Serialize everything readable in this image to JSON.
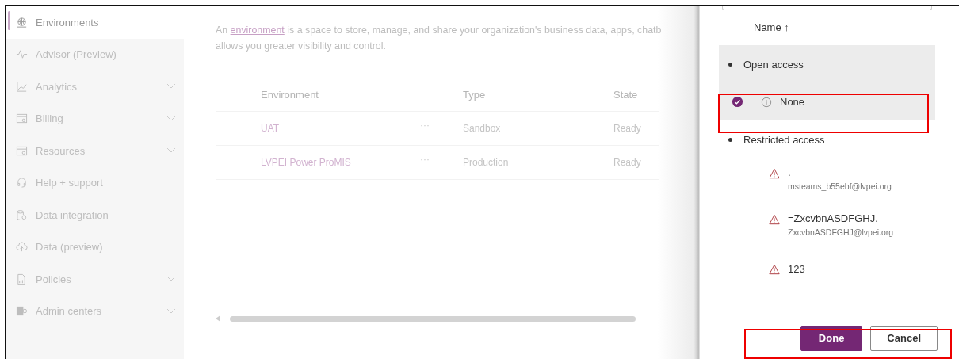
{
  "sidebar": {
    "items": [
      {
        "label": "Environments",
        "selected": true,
        "expandable": false
      },
      {
        "label": "Advisor (Preview)",
        "selected": false,
        "expandable": false
      },
      {
        "label": "Analytics",
        "selected": false,
        "expandable": true
      },
      {
        "label": "Billing",
        "selected": false,
        "expandable": true
      },
      {
        "label": "Resources",
        "selected": false,
        "expandable": true
      },
      {
        "label": "Help + support",
        "selected": false,
        "expandable": false
      },
      {
        "label": "Data integration",
        "selected": false,
        "expandable": false
      },
      {
        "label": "Data (preview)",
        "selected": false,
        "expandable": false
      },
      {
        "label": "Policies",
        "selected": false,
        "expandable": true
      },
      {
        "label": "Admin centers",
        "selected": false,
        "expandable": true
      }
    ]
  },
  "intro": {
    "before": "An ",
    "link": "environment",
    "after": " is a space to store, manage, and share your organization's business data, apps, chatb",
    "line2": "allows you greater visibility and control."
  },
  "table": {
    "columns": [
      "Environment",
      "Type",
      "State"
    ],
    "rows": [
      {
        "name": "UAT",
        "more": "···",
        "type": "Sandbox",
        "state": "Ready"
      },
      {
        "name": "LVPEI Power ProMIS",
        "more": "···",
        "type": "Production",
        "state": "Ready"
      }
    ]
  },
  "panel": {
    "sort_header": "Name ↑",
    "groups": [
      {
        "title": "Open access",
        "items": [
          {
            "kind": "info",
            "name": "None",
            "selected": true
          }
        ]
      },
      {
        "title": "Restricted access",
        "items": [
          {
            "kind": "warning",
            "name": ".",
            "email": "msteams_b55ebf@lvpei.org",
            "selected": false
          },
          {
            "kind": "warning",
            "name": "=ZxcvbnASDFGHJ.",
            "email": "ZxcvbnASDFGHJ@lvpei.org",
            "selected": false
          },
          {
            "kind": "warning",
            "name": "123",
            "selected": false
          }
        ]
      }
    ],
    "buttons": [
      {
        "label": "Done",
        "primary": true
      },
      {
        "label": "Cancel",
        "primary": false
      }
    ]
  }
}
